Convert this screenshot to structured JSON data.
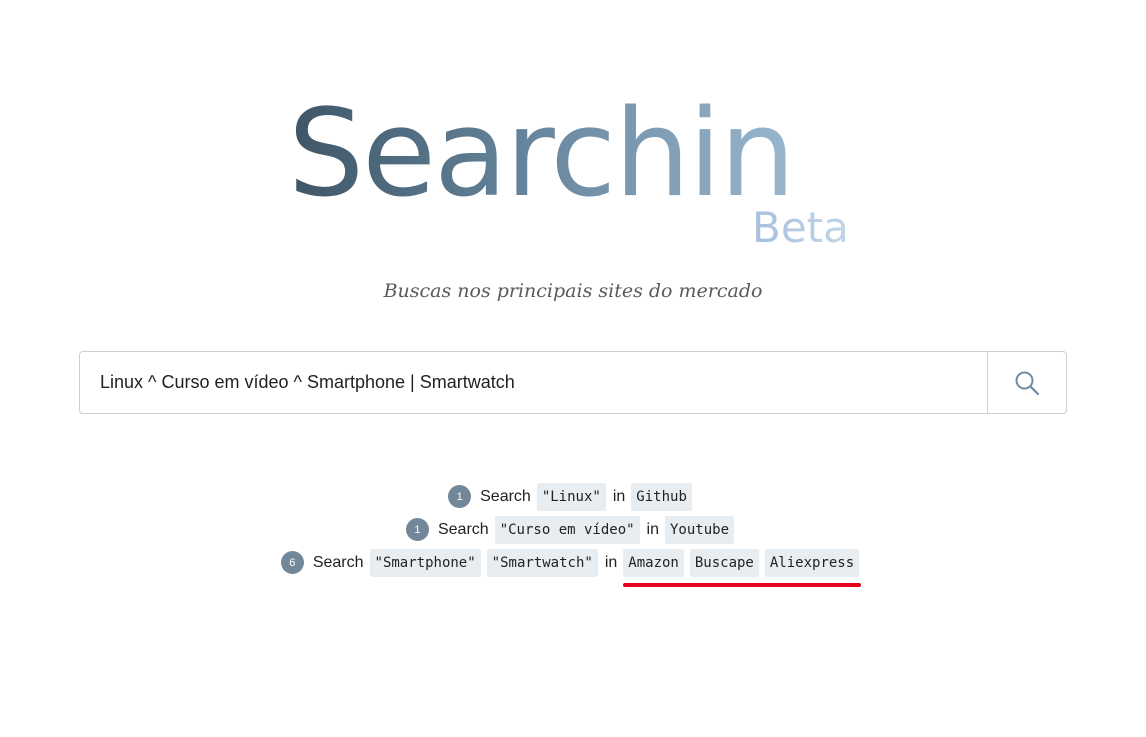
{
  "logo": {
    "title": "Searchin",
    "beta": "Beta"
  },
  "tagline": "Buscas nos principais sites do mercado",
  "search": {
    "value": "Linux ^ Curso em vídeo ^ Smartphone | Smartwatch",
    "button_icon": "search-icon"
  },
  "results": [
    {
      "count": "1",
      "label": "Search",
      "terms": [
        "\"Linux\""
      ],
      "in_label": "in",
      "sites": [
        "Github"
      ]
    },
    {
      "count": "1",
      "label": "Search",
      "terms": [
        "\"Curso em vídeo\""
      ],
      "in_label": "in",
      "sites": [
        "Youtube"
      ]
    },
    {
      "count": "6",
      "label": "Search",
      "terms": [
        "\"Smartphone\"",
        "\"Smartwatch\""
      ],
      "in_label": "in",
      "sites": [
        "Amazon",
        "Buscape",
        "Aliexpress"
      ]
    }
  ],
  "colors": {
    "accent_underline": "#e5001d",
    "badge": "#72889a",
    "chip_bg": "#e8edf1"
  }
}
